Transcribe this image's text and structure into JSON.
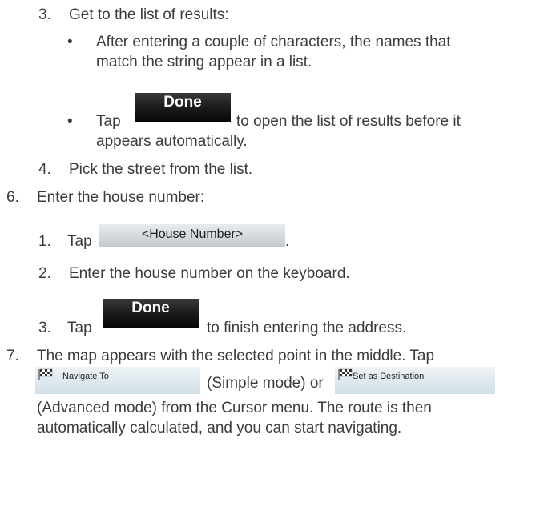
{
  "step3": {
    "num": "3.",
    "text": "Get to the list of results:"
  },
  "bullet1": {
    "mark": "•",
    "line1": "After entering a couple of characters, the names that",
    "line2": "match the string appear in a list."
  },
  "bullet2": {
    "mark": "•",
    "tap": "Tap",
    "after": "to open the list of results before it",
    "line2": "appears automatically."
  },
  "done_label": "Done",
  "step4": {
    "num": "4.",
    "text": "Pick the street from the list."
  },
  "step6": {
    "num": "6.",
    "text": "Enter the house number:"
  },
  "sub1": {
    "num": "1.",
    "tap": "Tap",
    "button": "<House Number>",
    "after": "."
  },
  "sub2": {
    "num": "2.",
    "text": "Enter the house number on the keyboard."
  },
  "sub3": {
    "num": "3.",
    "tap": "Tap",
    "after": "to finish entering the address."
  },
  "step7": {
    "num": "7.",
    "line1": "The map appears with the selected point in the middle. Tap",
    "navigate_button": "Navigate To",
    "simple": "(Simple mode) or",
    "destination_button": "Set as Destination",
    "line3": "(Advanced mode) from the Cursor menu. The route is then",
    "line4": "automatically calculated, and you can start navigating."
  },
  "icons": {
    "flag": "checkered-flag-icon",
    "bullet": "bullet"
  }
}
